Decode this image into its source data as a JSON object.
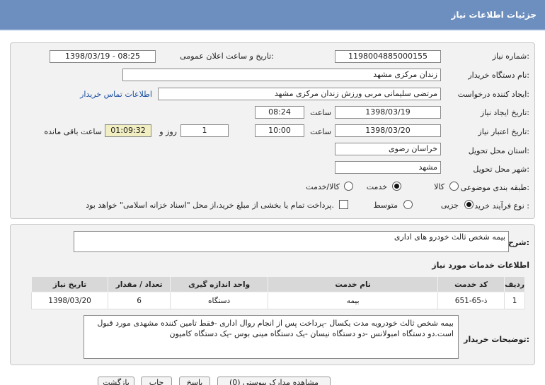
{
  "header": {
    "title": "جزئیات اطلاعات نیاز"
  },
  "form": {
    "need_number_label": "شماره نیاز:",
    "need_number": "1198004885000155",
    "announce_label": "تاریخ و ساعت اعلان عمومی:",
    "announce_value": "1398/03/19 - 08:25",
    "buyer_org_label": "نام دستگاه خریدار:",
    "buyer_org": "زندان مرکزی مشهد",
    "requester_label": "ایجاد کننده درخواست:",
    "requester": "مرتضی سلیمانی مربی ورزش زندان مرکزی مشهد",
    "contact_link": "اطلاعات تماس خریدار",
    "created_label": "تاریخ ایجاد نیاز:",
    "created_date": "1398/03/19",
    "time_label": "ساعت",
    "created_time": "08:24",
    "validity_label": "تاریخ اعتبار نیاز:",
    "validity_date": "1398/03/20",
    "validity_time": "10:00",
    "days_value": "1",
    "days_label": "روز و",
    "remaining_time": "01:09:32",
    "remaining_label": "ساعت باقی مانده",
    "province_label": "استان محل تحویل:",
    "province": "خراسان رضوی",
    "city_label": "شهر محل تحویل:",
    "city": "مشهد",
    "category_label": "طبقه بندی موضوعی:",
    "category_options": [
      "کالا",
      "خدمت",
      "کالا/خدمت"
    ],
    "process_label": "نوع فرآیند خرید :",
    "process_options": [
      "جزیی",
      "متوسط"
    ],
    "payment_note": "پرداخت تمام یا بخشی از مبلغ خرید،از محل \"اسناد خزانه اسلامی\" خواهد بود."
  },
  "summary": {
    "general_label": "شرح کلی نیاز:",
    "general_text": "بیمه شخص ثالث خودرو های اداری",
    "services_title": "اطلاعات خدمات مورد نیاز"
  },
  "table": {
    "headers": [
      "ردیف",
      "کد خدمت",
      "نام خدمت",
      "واحد اندازه گیری",
      "تعداد / مقدار",
      "تاریخ نیاز"
    ],
    "rows": [
      [
        "1",
        "ذ-65-651",
        "بیمه",
        "دستگاه",
        "6",
        "1398/03/20"
      ]
    ]
  },
  "buyer_desc": {
    "label": "توضیحات خریدار:",
    "text": "بیمه شخص ثالث خودرویه مدت یکسال -پرداخت پس از انجام روال اداری -فقط تامین کننده مشهدی مورد قبول است.دو دستگاه امبولانس -دو دستگاه نیسان -یک دستگاه مینی بوس -یک دستگاه کامیون"
  },
  "watermark": {
    "site": "ParsNamadData",
    "line1": "مرکز فراوری اطلاعات پارس نماد داده ها",
    "line2": "پایگاه اطلاع رسانی مناقصه ومزایده",
    "phone": "۰۲۱-۸۸۳۴۹۶۷۰-۵"
  },
  "footer": {
    "btn_view": "مشاهده مدارک پیوستی (0)",
    "btn_reply": "پاسخ",
    "btn_print": "چاپ",
    "btn_back": "بازگشت"
  }
}
